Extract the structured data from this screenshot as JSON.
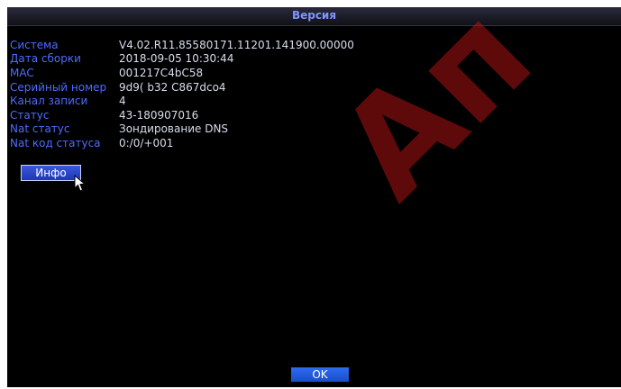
{
  "dialog": {
    "title": "Версия"
  },
  "info_rows": [
    {
      "label": "Система",
      "value": "V4.02.R11.85580171.11201.141900.00000"
    },
    {
      "label": "Дата сборки",
      "value": "2018-09-05 10:30:44"
    },
    {
      "label": "MAC",
      "value": "001217C4bC58"
    },
    {
      "label": "Серийный номер",
      "value": "9d9( b32 C867dco4"
    },
    {
      "label": "Канал записи",
      "value": "4"
    },
    {
      "label": "Статус",
      "value": "43-180907016"
    },
    {
      "label": "Nat статус",
      "value": "Зондирование DNS"
    },
    {
      "label": "Nat код статуса",
      "value": "0:/0/+001"
    }
  ],
  "buttons": {
    "info_label": "Инфо",
    "ok_label": "OK"
  },
  "colors": {
    "label": "#4d6cff",
    "value": "#d8dcec",
    "title": "#7e95ff",
    "background": "#000000",
    "button": "#2e4fd8",
    "watermark": "#e01818"
  },
  "icons": {
    "cursor": "mouse-pointer-icon"
  },
  "watermark": {
    "text": "Ап"
  }
}
